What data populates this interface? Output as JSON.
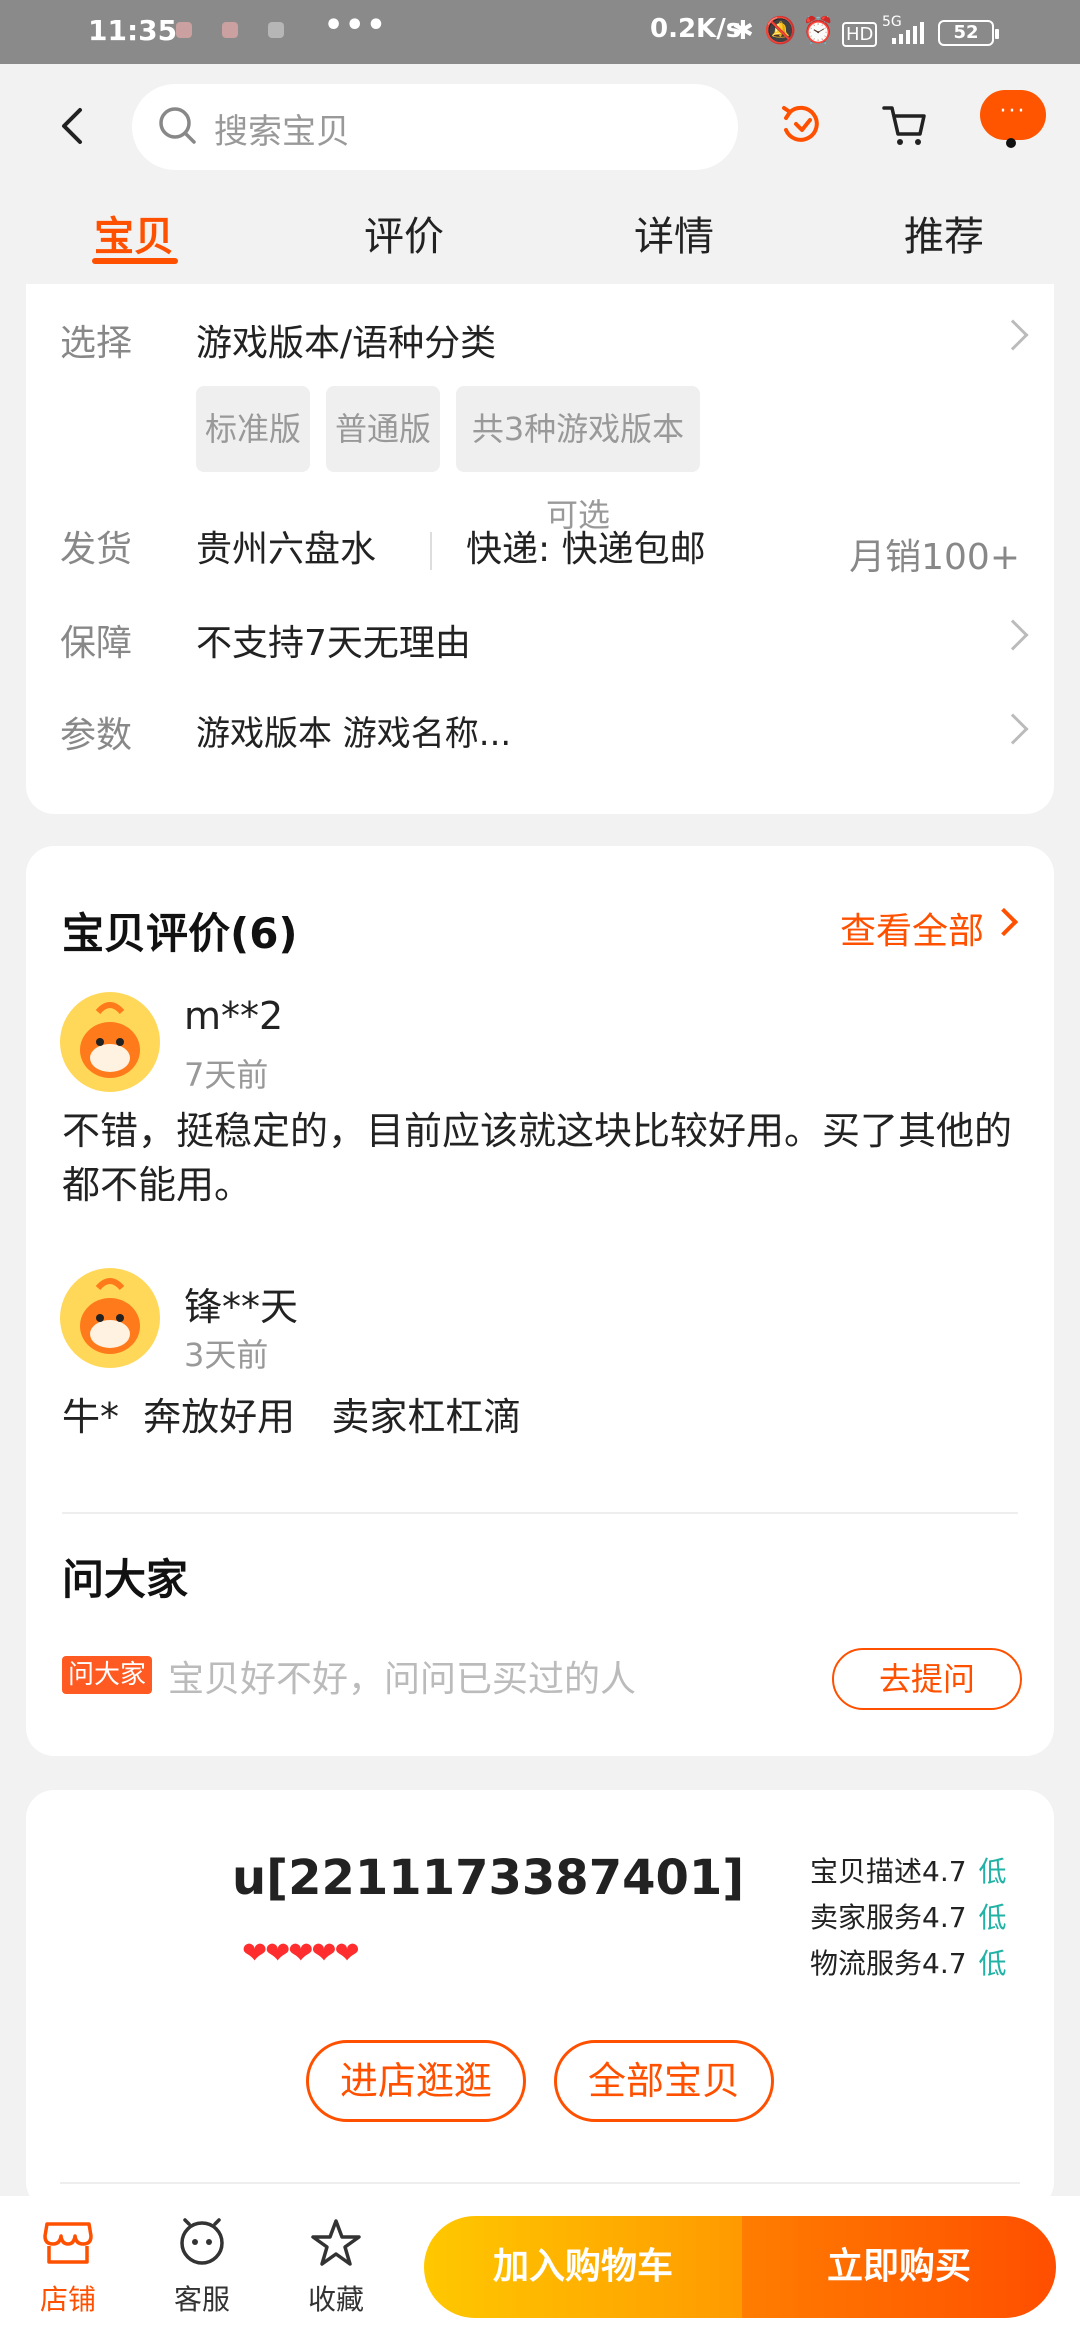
{
  "status_bar": {
    "time": "11:35",
    "net_speed": "0.2K/s",
    "signal": "5G",
    "hd": "HD",
    "battery": "52",
    "dots": "•••"
  },
  "header": {
    "search_placeholder": "搜索宝贝",
    "more_dots": "···"
  },
  "tabs": [
    {
      "label": "宝贝",
      "active": true
    },
    {
      "label": "评价",
      "active": false
    },
    {
      "label": "详情",
      "active": false
    },
    {
      "label": "推荐",
      "active": false
    }
  ],
  "spec": {
    "select_label": "选择",
    "select_value": "游戏版本/语种分类",
    "options": [
      "标准版",
      "普通版",
      "共3种游戏版本可选"
    ],
    "ship_label": "发货",
    "ship_from": "贵州六盘水",
    "ship_method": "快递: 快递包邮",
    "monthly_sales": "月销100+",
    "guarantee_label": "保障",
    "guarantee_value": "不支持7天无理由",
    "params_label": "参数",
    "params_value": "游戏版本 游戏名称..."
  },
  "reviews": {
    "title": "宝贝评价(6)",
    "view_all": "查看全部",
    "items": [
      {
        "user": "m**2",
        "date": "7天前",
        "text": "不错，挺稳定的，目前应该就这块比较好用。买了其他的都不能用。"
      },
      {
        "user": "锋**天",
        "date": "3天前",
        "text": "牛*  奔放好用   卖家杠杠滴"
      }
    ]
  },
  "ask": {
    "title": "问大家",
    "badge": "问大家",
    "placeholder": "宝贝好不好，问问已买过的人",
    "button": "去提问"
  },
  "shop": {
    "name": "u[2211173387401]",
    "hearts": "❤❤❤❤❤",
    "scores": [
      {
        "label": "宝贝描述",
        "score": "4.7",
        "level": "低"
      },
      {
        "label": "卖家服务",
        "score": "4.7",
        "level": "低"
      },
      {
        "label": "物流服务",
        "score": "4.7",
        "level": "低"
      }
    ],
    "enter_button": "进店逛逛",
    "all_items_button": "全部宝贝"
  },
  "bottom_bar": {
    "store": "店铺",
    "service": "客服",
    "favorite": "收藏",
    "add_to_cart": "加入购物车",
    "buy_now": "立即购买"
  },
  "colors": {
    "accent": "#ff5000",
    "level_low": "#22b3a6"
  }
}
